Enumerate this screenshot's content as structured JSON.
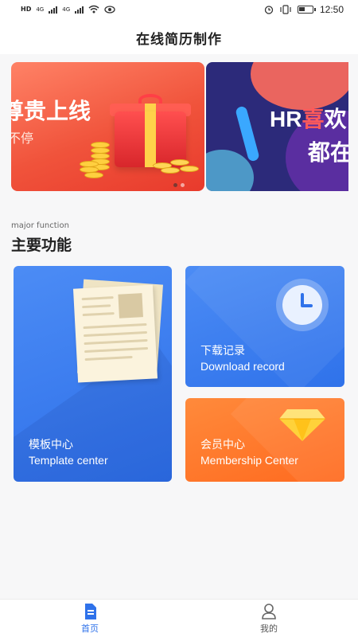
{
  "status_bar": {
    "time": "12:50",
    "left_labels": [
      "HD",
      "4G",
      "4G"
    ],
    "icons": [
      "signal-icon",
      "wifi-icon",
      "eye-icon",
      "alarm-icon",
      "vibrate-icon",
      "battery-icon"
    ]
  },
  "header": {
    "title": "在线简历制作"
  },
  "banner": {
    "slides": [
      {
        "title": "尊贵上线",
        "subtitle": "不停"
      },
      {
        "title_prefix": "HR",
        "title_highlight": "喜",
        "title_suffix": "欢",
        "subtitle": "都在"
      }
    ],
    "active_index": 0,
    "slide_count": 2
  },
  "section": {
    "en": "major function",
    "title": "主要功能"
  },
  "cards": {
    "template": {
      "cn": "模板中心",
      "en": "Template center"
    },
    "download": {
      "cn": "下载记录",
      "en": "Download record"
    },
    "member": {
      "cn": "会员中心",
      "en": "Membership Center"
    }
  },
  "tabs": {
    "home": {
      "label": "首页",
      "active": true
    },
    "mine": {
      "label": "我的",
      "active": false
    }
  },
  "colors": {
    "accent_blue": "#2f72ea",
    "card_orange": "#ff6a1f",
    "banner_red": "#f0533b",
    "banner_navy": "#2c2a7a"
  }
}
